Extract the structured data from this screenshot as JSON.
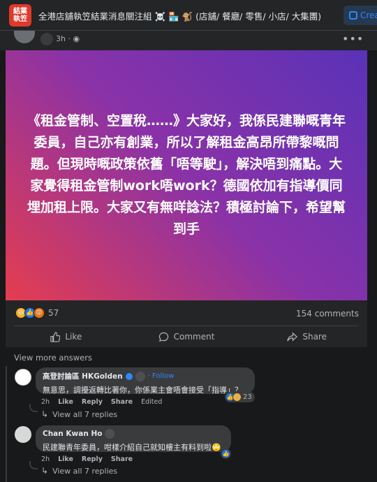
{
  "header": {
    "logo_line1": "結業",
    "logo_line2": "執笠",
    "group_title": "全港店舖執笠結業消息關注組 ☠️ 🏪 🐒 (店舖/ 餐廳/ 零售/ 小店/ 大集團)",
    "create_label": "Crea"
  },
  "post": {
    "time": "3h",
    "text": "《租金管制、空置稅……》大家好，我係民建聯嘅青年委員，自己亦有創業，所以了解租金高昂所帶黎嘅問題。但現時嘅政策依舊「唔等駛」，解決唔到痛點。大家覺得租金管制work唔work？德國依加有指導價同埋加租上限。大家又有無咩諗法？積極討論下，希望幫到手",
    "reaction_count": "57",
    "comment_count": "154 comments",
    "actions": {
      "like": "Like",
      "comment": "Comment",
      "share": "Share"
    },
    "gradient_colors": [
      "#e43d4f",
      "#8a32a8",
      "#5a32b8"
    ]
  },
  "comments": {
    "view_more": "View more answers",
    "items": [
      {
        "name": "高登討論區 HKGolden",
        "follow": "· Follow",
        "text": "無意思，調擾返轉比著你，你係業主會唔會接受「指導」？",
        "time": "2h",
        "like": "Like",
        "reply": "Reply",
        "share": "Share",
        "edited": "Edited",
        "reaction_count": "23",
        "view_replies": "View all 7 replies"
      },
      {
        "name": "Chan Kwan Ho",
        "text": "民建聯青年委員，咁樣介紹自己就知樓主有料到啦🙄",
        "time": "2h",
        "like": "Like",
        "reply": "Reply",
        "share": "Share",
        "view_replies": "View all 7 replies"
      }
    ]
  }
}
